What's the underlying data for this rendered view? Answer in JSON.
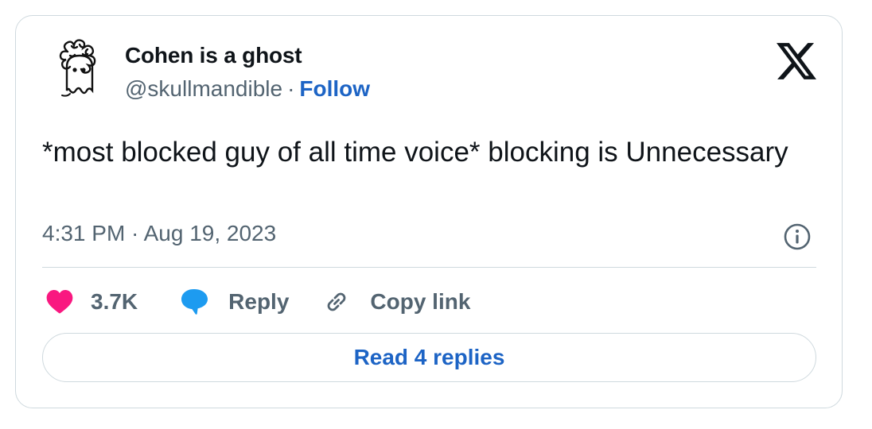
{
  "author": {
    "display_name": "Cohen is a ghost",
    "handle": "@skullmandible",
    "separator": "·",
    "follow_label": "Follow",
    "avatar_icon": "curly-haired-ghost-avatar"
  },
  "platform_icon": "x-logo-icon",
  "tweet": {
    "text": "*most blocked guy of all time voice* blocking is Unnecessary",
    "timestamp": "4:31 PM · Aug 19, 2023"
  },
  "actions": {
    "like": {
      "icon": "heart-icon",
      "count": "3.7K",
      "color": "#f91880"
    },
    "reply": {
      "icon": "speech-bubble-icon",
      "label": "Reply",
      "color": "#1d9bf0"
    },
    "copy_link": {
      "icon": "link-icon",
      "label": "Copy link"
    }
  },
  "read_replies_label": "Read 4 replies",
  "colors": {
    "accent_blue": "#1d64c5",
    "text_primary": "#0f1419",
    "text_secondary": "#536471",
    "border": "#cfd9de"
  }
}
